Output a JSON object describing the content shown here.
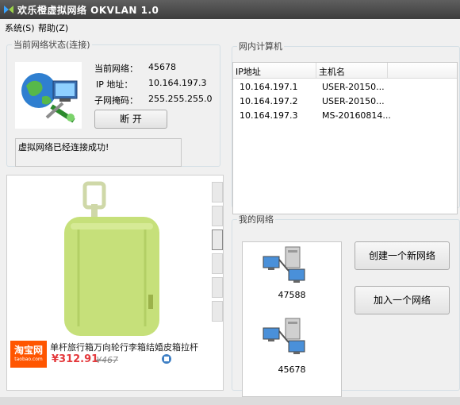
{
  "window": {
    "title": "欢乐橙虚拟网络 OKVLAN 1.0"
  },
  "menu": {
    "items": [
      {
        "label": "系统(S)"
      },
      {
        "label": "帮助(Z)"
      }
    ]
  },
  "status": {
    "legend": "当前网络状态(连接)",
    "network_label": "当前网络：",
    "network_value": "45678",
    "ip_label": "IP  地址：",
    "ip_value": "10.164.197.3",
    "mask_label": "子网掩码：",
    "mask_value": "255.255.255.0",
    "disconnect_label": "断  开",
    "message": "虚拟网络已经连接成功!"
  },
  "computers": {
    "legend": "网内计算机",
    "columns": [
      "IP地址",
      "主机名"
    ],
    "rows": [
      {
        "ip": "10.164.197.1",
        "host": "USER-20150..."
      },
      {
        "ip": "10.164.197.2",
        "host": "USER-20150..."
      },
      {
        "ip": "10.164.197.3",
        "host": "MS-20160814..."
      }
    ]
  },
  "ad": {
    "caption": "单杆旅行箱万向轮行李箱结婚皮箱拉杆",
    "logo_main": "淘宝网",
    "logo_sub": "taobao.com",
    "price": "¥312.91",
    "old_price": "¥467"
  },
  "mynetworks": {
    "legend": "我的网络",
    "networks": [
      {
        "name": "47588"
      },
      {
        "name": "45678"
      }
    ],
    "create_label": "创建一个新网络",
    "join_label": "加入一个网络"
  },
  "colors": {
    "price": "#e4393c",
    "taobao": "#ff5500",
    "suitcase": "#c6e07a"
  }
}
